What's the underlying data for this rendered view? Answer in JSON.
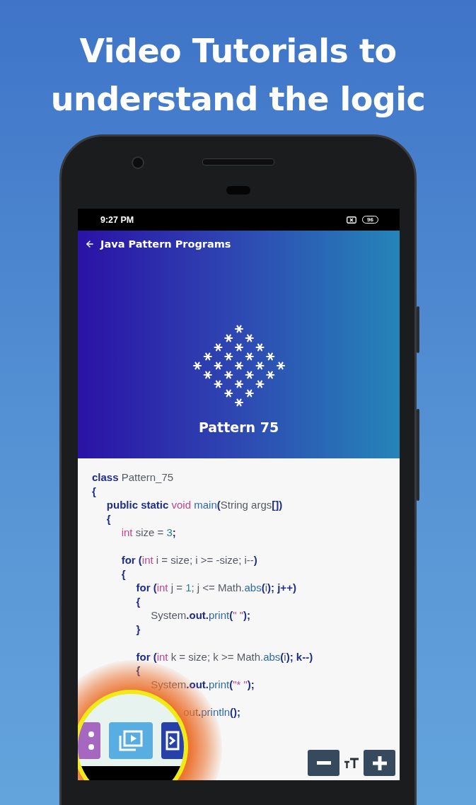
{
  "headline": "Video Tutorials to understand the logic",
  "status_bar": {
    "time": "9:27 PM",
    "battery": "96"
  },
  "app_bar": {
    "title": "Java Pattern Programs"
  },
  "hero": {
    "title": "Pattern 75"
  },
  "code": [
    {
      "kind": "code",
      "tokens": [
        {
          "kind": "kw",
          "text": "class"
        },
        {
          "kind": "plain",
          "text": " Pattern_75"
        }
      ]
    },
    {
      "kind": "code",
      "tokens": [
        {
          "kind": "kw",
          "text": "{"
        }
      ]
    },
    {
      "kind": "code",
      "tokens": [
        {
          "kind": "kw",
          "text": "     public static"
        },
        {
          "kind": "type",
          "text": " void"
        },
        {
          "kind": "fn",
          "text": " main"
        },
        {
          "kind": "kw",
          "text": "("
        },
        {
          "kind": "plain",
          "text": "String args"
        },
        {
          "kind": "kw",
          "text": "[])"
        }
      ]
    },
    {
      "kind": "code",
      "tokens": [
        {
          "kind": "kw",
          "text": "     {"
        }
      ]
    },
    {
      "kind": "code",
      "tokens": [
        {
          "kind": "type",
          "text": "          int"
        },
        {
          "kind": "plain",
          "text": " size = "
        },
        {
          "kind": "num",
          "text": "3"
        },
        {
          "kind": "kw",
          "text": ";"
        }
      ]
    },
    {
      "kind": "blank"
    },
    {
      "kind": "code",
      "tokens": [
        {
          "kind": "kw",
          "text": "          for ("
        },
        {
          "kind": "type",
          "text": "int"
        },
        {
          "kind": "plain",
          "text": " i = size; i >= -size; i--"
        },
        {
          "kind": "kw",
          "text": ")"
        }
      ]
    },
    {
      "kind": "code",
      "tokens": [
        {
          "kind": "kw",
          "text": "          {"
        }
      ]
    },
    {
      "kind": "code",
      "tokens": [
        {
          "kind": "kw",
          "text": "               for ("
        },
        {
          "kind": "type",
          "text": "int"
        },
        {
          "kind": "plain",
          "text": " j = "
        },
        {
          "kind": "num",
          "text": "1"
        },
        {
          "kind": "plain",
          "text": "; j <= Math."
        },
        {
          "kind": "fn",
          "text": "abs"
        },
        {
          "kind": "kw",
          "text": "("
        },
        {
          "kind": "plain",
          "text": "i"
        },
        {
          "kind": "kw",
          "text": "); j++)"
        }
      ]
    },
    {
      "kind": "code",
      "tokens": [
        {
          "kind": "kw",
          "text": "               {"
        }
      ]
    },
    {
      "kind": "code",
      "tokens": [
        {
          "kind": "plain",
          "text": "                    System"
        },
        {
          "kind": "kw",
          "text": ".out."
        },
        {
          "kind": "fn",
          "text": "print"
        },
        {
          "kind": "kw",
          "text": "("
        },
        {
          "kind": "str",
          "text": "\" \""
        },
        {
          "kind": "kw",
          "text": ");"
        }
      ]
    },
    {
      "kind": "code",
      "tokens": [
        {
          "kind": "kw",
          "text": "               }"
        }
      ]
    },
    {
      "kind": "blank"
    },
    {
      "kind": "code",
      "tokens": [
        {
          "kind": "kw",
          "text": "               for ("
        },
        {
          "kind": "type",
          "text": "int"
        },
        {
          "kind": "plain",
          "text": " k = size; k >= Math."
        },
        {
          "kind": "fn",
          "text": "abs"
        },
        {
          "kind": "kw",
          "text": "("
        },
        {
          "kind": "plain",
          "text": "i"
        },
        {
          "kind": "kw",
          "text": "); k--)"
        }
      ]
    },
    {
      "kind": "code",
      "tokens": [
        {
          "kind": "kw",
          "text": "               {"
        }
      ]
    },
    {
      "kind": "code",
      "tokens": [
        {
          "kind": "plain",
          "text": "                    System"
        },
        {
          "kind": "kw",
          "text": ".out."
        },
        {
          "kind": "fn",
          "text": "print"
        },
        {
          "kind": "kw",
          "text": "("
        },
        {
          "kind": "str",
          "text": "\"* \""
        },
        {
          "kind": "kw",
          "text": ");"
        }
      ]
    },
    {
      "kind": "blank"
    },
    {
      "kind": "code",
      "tokens": [
        {
          "kind": "plain",
          "text": "                               out"
        },
        {
          "kind": "kw",
          "text": "."
        },
        {
          "kind": "fn",
          "text": "println"
        },
        {
          "kind": "kw",
          "text": "();"
        }
      ]
    }
  ]
}
